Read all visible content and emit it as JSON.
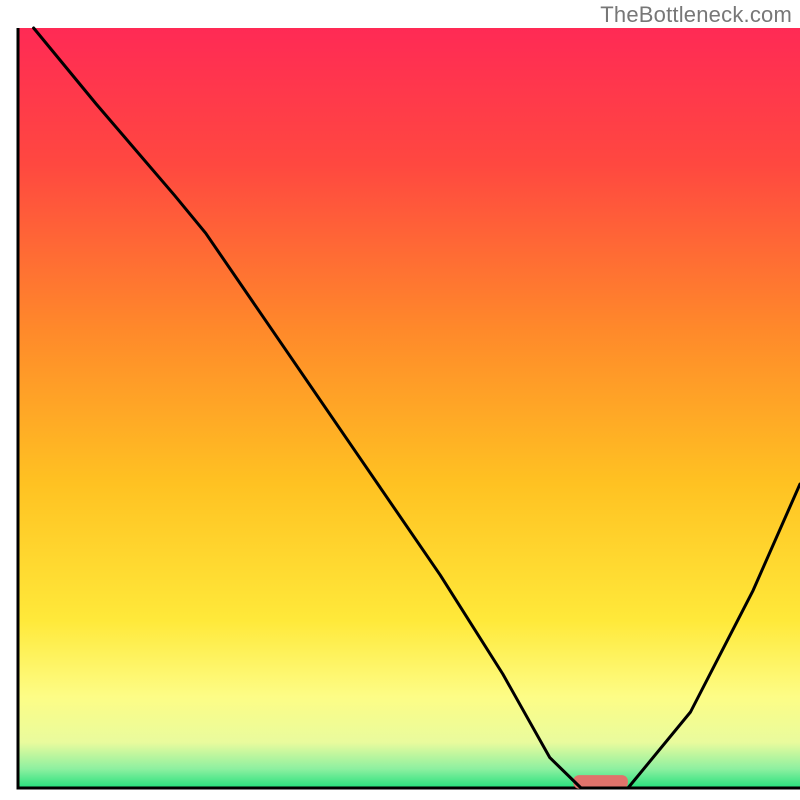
{
  "watermark": "TheBottleneck.com",
  "chart_data": {
    "type": "line",
    "title": "",
    "xlabel": "",
    "ylabel": "",
    "xlim": [
      0,
      100
    ],
    "ylim": [
      0,
      100
    ],
    "grid": false,
    "legend": null,
    "background_gradient": [
      {
        "offset": 0.0,
        "color": "#ff2a55"
      },
      {
        "offset": 0.18,
        "color": "#ff4840"
      },
      {
        "offset": 0.4,
        "color": "#ff8a2a"
      },
      {
        "offset": 0.6,
        "color": "#ffc222"
      },
      {
        "offset": 0.78,
        "color": "#ffe93a"
      },
      {
        "offset": 0.88,
        "color": "#fdfd86"
      },
      {
        "offset": 0.94,
        "color": "#e9fb9d"
      },
      {
        "offset": 0.975,
        "color": "#8df0a0"
      },
      {
        "offset": 1.0,
        "color": "#25e07c"
      }
    ],
    "series": [
      {
        "name": "bottleneck-curve",
        "x": [
          2,
          10,
          20,
          24,
          34,
          44,
          54,
          62,
          68,
          72,
          78,
          86,
          94,
          100
        ],
        "y": [
          100,
          90,
          78,
          73,
          58,
          43,
          28,
          15,
          4,
          0,
          0,
          10,
          26,
          40
        ]
      }
    ],
    "annotations": [
      {
        "name": "optimal-marker",
        "shape": "rounded-rect",
        "x_center": 74.5,
        "y_center": 0.8,
        "width": 7.0,
        "height": 1.8,
        "color": "#e0736b"
      }
    ],
    "axis_stroke": "#000000",
    "curve_stroke": "#000000"
  }
}
